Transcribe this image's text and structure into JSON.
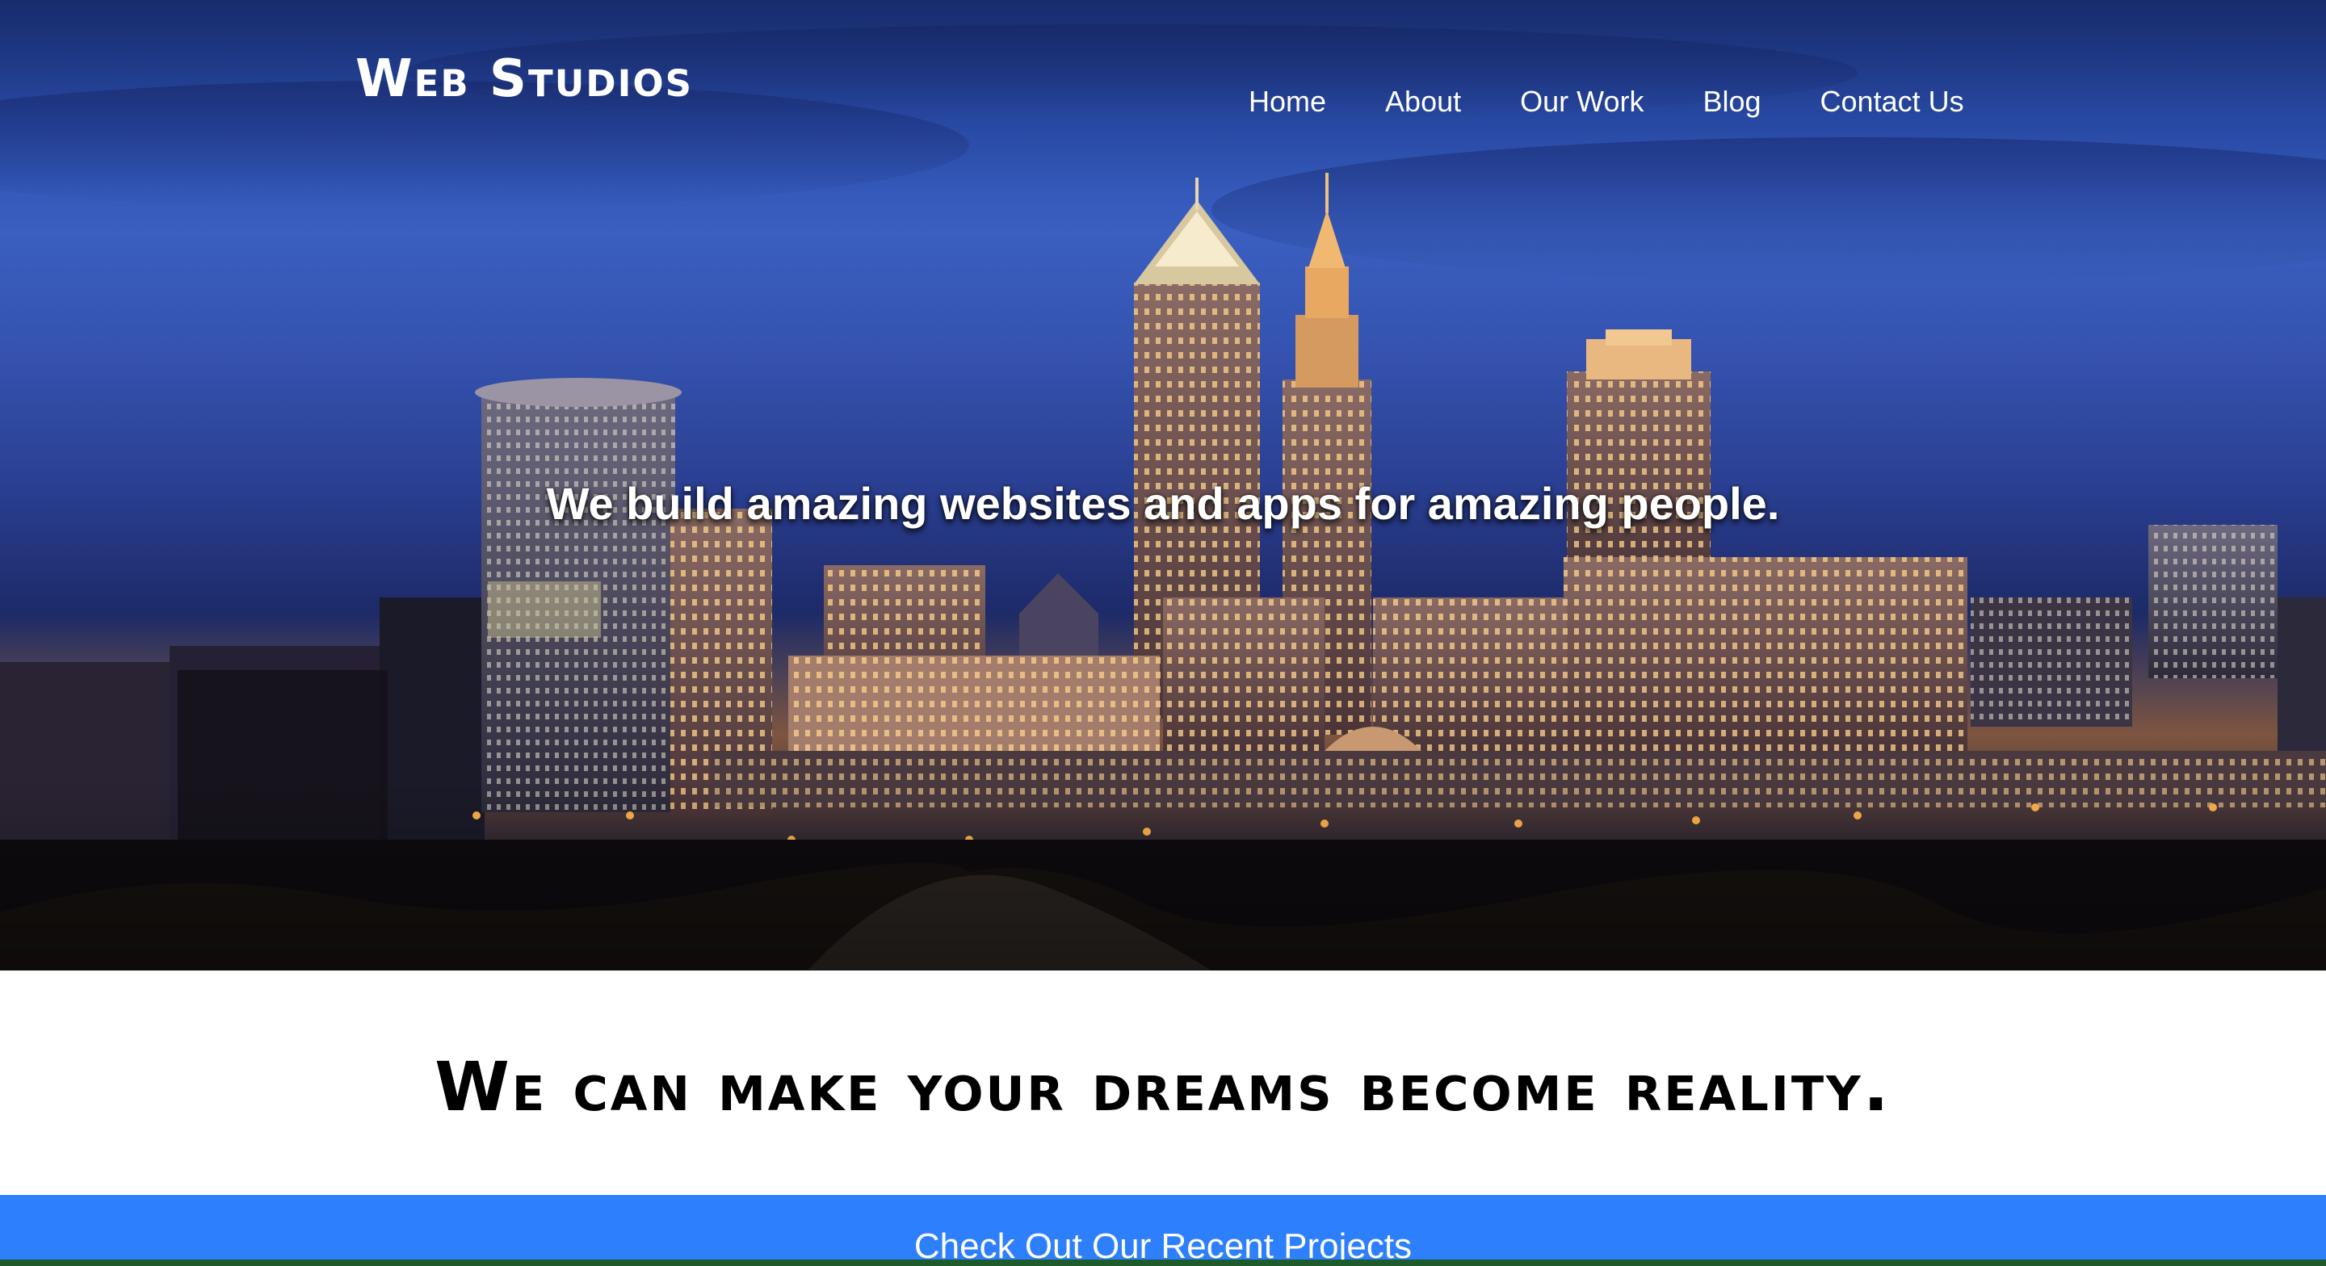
{
  "header": {
    "brand": "Web Studios",
    "nav": [
      {
        "label": "Home"
      },
      {
        "label": "About"
      },
      {
        "label": "Our Work"
      },
      {
        "label": "Blog"
      },
      {
        "label": "Contact Us"
      }
    ]
  },
  "hero": {
    "tagline": "We build amazing websites and apps for amazing people.",
    "background": "city-skyline-at-dusk"
  },
  "dreams": {
    "heading": "We can make your dreams become reality."
  },
  "projects": {
    "link_label": "Check Out Our Recent Projects"
  },
  "colors": {
    "sky": "#2b4fb0",
    "accent_bar": "#2d7ffb",
    "text_light": "#ffffff",
    "text_dark": "#000000"
  }
}
